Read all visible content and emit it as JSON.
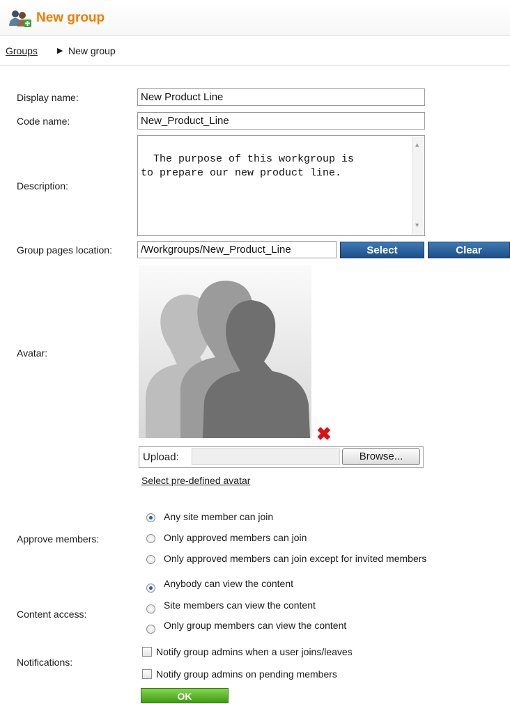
{
  "header": {
    "title": "New group",
    "icon": "group-add-icon"
  },
  "breadcrumb": {
    "parent": "Groups",
    "separator": "▶",
    "current": "New group"
  },
  "form": {
    "display_name": {
      "label": "Display name:",
      "value": "New Product Line"
    },
    "code_name": {
      "label": "Code name:",
      "value": "New_Product_Line"
    },
    "description": {
      "label": "Description:",
      "value": "The purpose of this workgroup is\nto prepare our new product line."
    },
    "pages_location": {
      "label": "Group pages location:",
      "value": "/Workgroups/New_Product_Line",
      "select_label": "Select",
      "clear_label": "Clear"
    },
    "avatar": {
      "label": "Avatar:",
      "delete_icon": "delete-icon",
      "upload_label": "Upload:",
      "browse_label": "Browse...",
      "predefined_link": "Select pre-defined avatar"
    },
    "approve_members": {
      "label": "Approve members:",
      "options": [
        "Any site member can join",
        "Only approved members can join",
        "Only approved members can join except for invited members"
      ],
      "selected": 0
    },
    "content_access": {
      "label": "Content access:",
      "options": [
        "Anybody can view the content",
        "Site members can view the content",
        "Only group members can view the content"
      ],
      "selected": 0
    },
    "notifications": {
      "label": "Notifications:",
      "options": [
        "Notify group admins when a user joins/leaves",
        "Notify group admins on pending members"
      ],
      "checked": [
        false,
        false
      ]
    },
    "ok_label": "OK"
  },
  "colors": {
    "title": "#f07d00",
    "blue_button": "#2a5f99",
    "green_button": "#5cb82a"
  }
}
